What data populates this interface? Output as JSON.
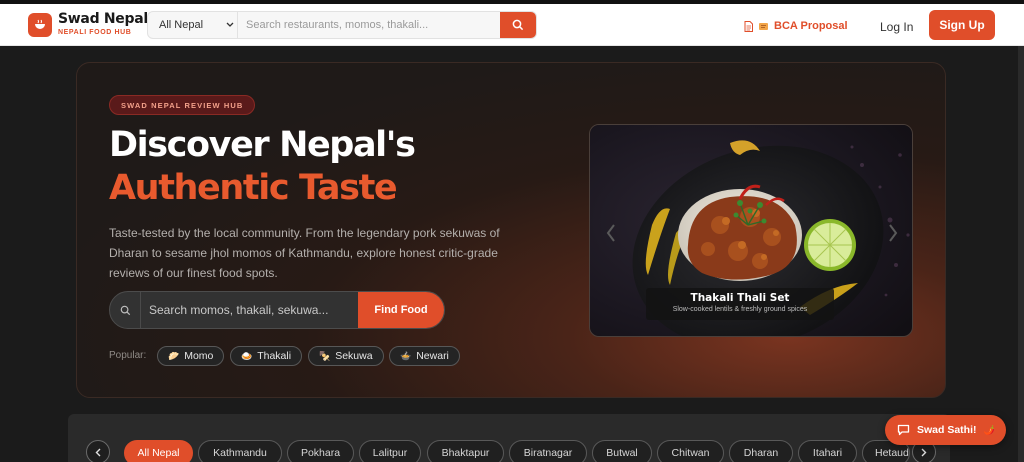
{
  "brand": {
    "name": "Swad Nepal",
    "tagline": "NEPALI FOOD HUB",
    "accent": "#e04e2a"
  },
  "header": {
    "region": "All Nepal",
    "search_placeholder": "Search restaurants, momos, thakali...",
    "bca_link": "BCA Proposal",
    "login": "Log In",
    "signup": "Sign Up"
  },
  "hero": {
    "badge": "SWAD NEPAL REVIEW HUB",
    "title_line1": "Discover Nepal's",
    "title_line2": "Authentic Taste",
    "description": "Taste-tested by the local community. From the legendary pork sekuwas of Dharan to sesame jhol momos of Kathmandu, explore honest critic-grade reviews of our finest food spots.",
    "search_placeholder": "Search momos, thakali, sekuwa...",
    "find_button": "Find Food",
    "popular_label": "Popular:",
    "popular": [
      {
        "emoji": "🥟",
        "label": "Momo"
      },
      {
        "emoji": "🍛",
        "label": "Thakali"
      },
      {
        "emoji": "🍢",
        "label": "Sekuwa"
      },
      {
        "emoji": "🍲",
        "label": "Newari"
      }
    ],
    "featured": {
      "title": "Thakali Thali Set",
      "subtitle": "Slow-cooked lentils & freshly ground spices"
    }
  },
  "cities": [
    "All Nepal",
    "Kathmandu",
    "Pokhara",
    "Lalitpur",
    "Bhaktapur",
    "Biratnagar",
    "Butwal",
    "Chitwan",
    "Dharan",
    "Itahari",
    "Hetauda"
  ],
  "chat": {
    "label": "Swad Sathi!",
    "emoji": "🌶️"
  }
}
